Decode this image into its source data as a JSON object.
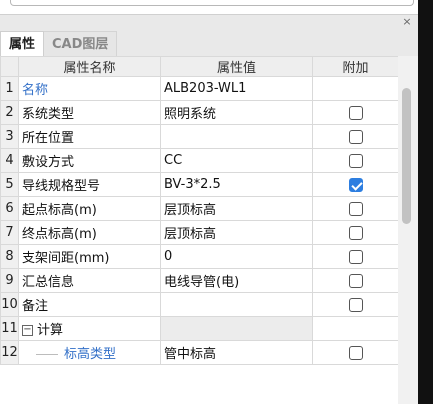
{
  "panel": {
    "close_label": "×"
  },
  "tabs": [
    {
      "label": "属性",
      "active": true
    },
    {
      "label": "CAD图层",
      "active": false
    }
  ],
  "table": {
    "headers": [
      "",
      "属性名称",
      "属性值",
      "附加"
    ],
    "rows": [
      {
        "index": "1",
        "name": "名称",
        "value": "ALB203-WL1",
        "checkbox": "none",
        "link": true
      },
      {
        "index": "2",
        "name": "系统类型",
        "value": "照明系统",
        "checkbox": "unchecked"
      },
      {
        "index": "3",
        "name": "所在位置",
        "value": "",
        "checkbox": "unchecked"
      },
      {
        "index": "4",
        "name": "敷设方式",
        "value": "CC",
        "checkbox": "unchecked"
      },
      {
        "index": "5",
        "name": "导线规格型号",
        "value": "BV-3*2.5",
        "checkbox": "checked"
      },
      {
        "index": "6",
        "name": "起点标高(m)",
        "value": "层顶标高",
        "checkbox": "unchecked"
      },
      {
        "index": "7",
        "name": "终点标高(m)",
        "value": "层顶标高",
        "checkbox": "unchecked"
      },
      {
        "index": "8",
        "name": "支架间距(mm)",
        "value": "0",
        "checkbox": "unchecked"
      },
      {
        "index": "9",
        "name": "汇总信息",
        "value": "电线导管(电)",
        "checkbox": "unchecked"
      },
      {
        "index": "10",
        "name": "备注",
        "value": "",
        "checkbox": "unchecked"
      },
      {
        "index": "11",
        "name": "计算",
        "value": "",
        "checkbox": "none",
        "group": true,
        "expander": "−"
      },
      {
        "index": "12",
        "name": "标高类型",
        "value": "管中标高",
        "checkbox": "unchecked",
        "child": true,
        "link": true
      }
    ]
  }
}
